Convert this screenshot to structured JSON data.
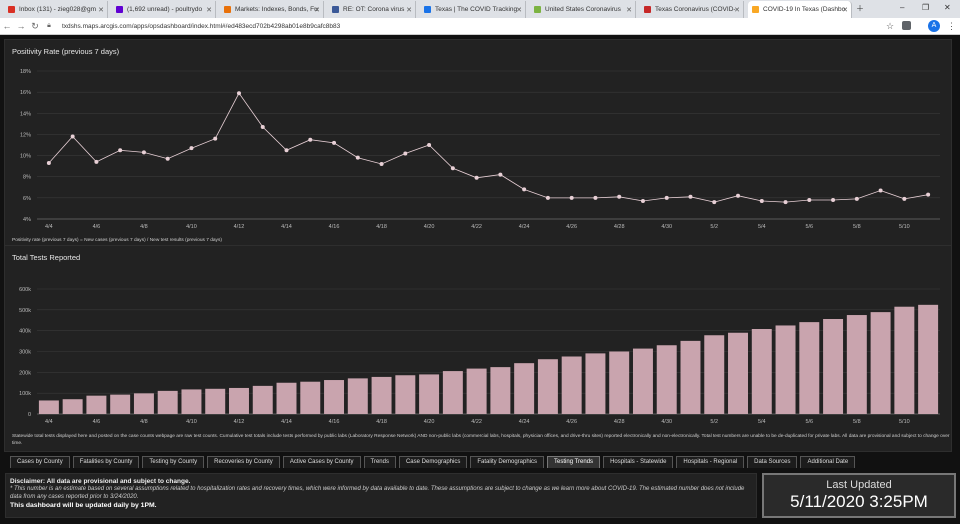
{
  "browser": {
    "tabs": [
      {
        "label": "Inbox (131) - zieg028@gm",
        "color": "#d93025"
      },
      {
        "label": "(1,692 unread) - poultrydo",
        "color": "#6001d2"
      },
      {
        "label": "Markets: Indexes, Bonds, Fu",
        "color": "#e8710a"
      },
      {
        "label": "RE: OT: Corona virus",
        "color": "#3b5998"
      },
      {
        "label": "Texas | The COVID Tracking",
        "color": "#1a73e8"
      },
      {
        "label": "United States Coronavirus",
        "color": "#7cb342"
      },
      {
        "label": "Texas Coronavirus (COVID-",
        "color": "#c62828"
      },
      {
        "label": "COVID-19 In Texas (Dashbo",
        "color": "#f9a825"
      }
    ],
    "url": "txdshs.maps.arcgis.com/apps/opsdashboard/index.html#/ed483ecd702b4298ab01e8b9cafc8b83",
    "profile_initial": "A"
  },
  "positivity": {
    "title": "Positivity Rate (previous 7 days)",
    "footnote": "Positivity rate (previous 7 days) = New cases (previous 7 days) / New test results (previous 7 days)"
  },
  "tests": {
    "title": "Total Tests Reported",
    "footnote": "Statewide total tests displayed here and posted on the case counts webpage are raw test counts. Cumulative test totals include tests performed by public labs (Laboratory Response Network) AND non-public labs (commercial labs, hospitals, physician offices, and drive-thru sites) reported electronically and non-electronically. Total test numbers are unable to be de-duplicated for private labs. All data are provisional and subject to change over time."
  },
  "chart_data": [
    {
      "type": "line",
      "title": "Positivity Rate (previous 7 days)",
      "x": [
        "4/4",
        "4/5",
        "4/6",
        "4/7",
        "4/8",
        "4/9",
        "4/10",
        "4/11",
        "4/12",
        "4/13",
        "4/14",
        "4/15",
        "4/16",
        "4/17",
        "4/18",
        "4/19",
        "4/20",
        "4/21",
        "4/22",
        "4/23",
        "4/24",
        "4/25",
        "4/26",
        "4/27",
        "4/28",
        "4/29",
        "4/30",
        "5/1",
        "5/2",
        "5/3",
        "5/4",
        "5/5",
        "5/6",
        "5/7",
        "5/8",
        "5/9",
        "5/10",
        "5/11"
      ],
      "values": [
        9.3,
        11.8,
        9.4,
        10.5,
        10.3,
        9.7,
        10.7,
        11.6,
        15.9,
        12.7,
        10.5,
        11.5,
        11.2,
        9.8,
        9.2,
        10.2,
        11.0,
        8.8,
        7.9,
        8.2,
        6.8,
        6.0,
        6.0,
        6.0,
        6.1,
        5.7,
        6.0,
        6.1,
        5.6,
        6.2,
        5.7,
        5.6,
        5.8,
        5.8,
        5.9,
        6.7,
        5.9,
        6.3
      ],
      "ylim": [
        4,
        18
      ],
      "yticks": [
        "4%",
        "6%",
        "8%",
        "10%",
        "12%",
        "14%",
        "16%",
        "18%"
      ],
      "xticks": [
        "4/4",
        "4/6",
        "4/8",
        "4/10",
        "4/12",
        "4/14",
        "4/16",
        "4/18",
        "4/20",
        "4/22",
        "4/24",
        "4/26",
        "4/28",
        "4/30",
        "5/2",
        "5/4",
        "5/6",
        "5/8",
        "5/10"
      ],
      "line_color": "#e8d0d6",
      "grid": true
    },
    {
      "type": "bar",
      "title": "Total Tests Reported",
      "categories": [
        "4/4",
        "4/5",
        "4/6",
        "4/7",
        "4/8",
        "4/9",
        "4/10",
        "4/11",
        "4/12",
        "4/13",
        "4/14",
        "4/15",
        "4/16",
        "4/17",
        "4/18",
        "4/19",
        "4/20",
        "4/21",
        "4/22",
        "4/23",
        "4/24",
        "4/25",
        "4/26",
        "4/27",
        "4/28",
        "4/29",
        "4/30",
        "5/1",
        "5/2",
        "5/3",
        "5/4",
        "5/5",
        "5/6",
        "5/7",
        "5/8",
        "5/9",
        "5/10",
        "5/11"
      ],
      "values": [
        65000,
        71000,
        88000,
        93000,
        99000,
        111000,
        118000,
        121000,
        125000,
        135000,
        150000,
        155000,
        163000,
        171000,
        178000,
        186000,
        190000,
        206000,
        218000,
        225000,
        244000,
        263000,
        276000,
        291000,
        300000,
        314000,
        330000,
        351000,
        378000,
        390000,
        408000,
        425000,
        441000,
        456000,
        475000,
        489000,
        515000,
        524000
      ],
      "ylim": [
        0,
        600000
      ],
      "yticks": [
        "0",
        "100k",
        "200k",
        "300k",
        "400k",
        "500k",
        "600k"
      ],
      "xticks": [
        "4/4",
        "4/6",
        "4/8",
        "4/10",
        "4/12",
        "4/14",
        "4/16",
        "4/18",
        "4/20",
        "4/22",
        "4/24",
        "4/26",
        "4/28",
        "4/30",
        "5/2",
        "5/4",
        "5/6",
        "5/8",
        "5/10"
      ],
      "bar_color": "#c9a4ae",
      "grid": true
    }
  ],
  "dash_tabs": [
    {
      "label": "Cases by County"
    },
    {
      "label": "Fatalities by County"
    },
    {
      "label": "Testing by County"
    },
    {
      "label": "Recoveries by County"
    },
    {
      "label": "Active Cases by County"
    },
    {
      "label": "Trends"
    },
    {
      "label": "Case Demographics"
    },
    {
      "label": "Fatality Demographics"
    },
    {
      "label": "Testing Trends",
      "active": true
    },
    {
      "label": "Hospitals - Statewide"
    },
    {
      "label": "Hospitals - Regional"
    },
    {
      "label": "Data Sources"
    },
    {
      "label": "Additional Date"
    }
  ],
  "disclaimer": {
    "title": "Disclaimer: All data are provisional and subject to change.",
    "text": "* This number is an estimate based on several assumptions related to hospitalization rates and recovery times, which were informed by data available to date. These assumptions are subject to change as we learn more about COVID-19. The estimated number does not include data from any cases reported prior to 3/24/2020.",
    "note": "This dashboard will be updated daily by 1PM."
  },
  "last_updated": {
    "label": "Last Updated",
    "value": "5/11/2020 3:25PM"
  }
}
